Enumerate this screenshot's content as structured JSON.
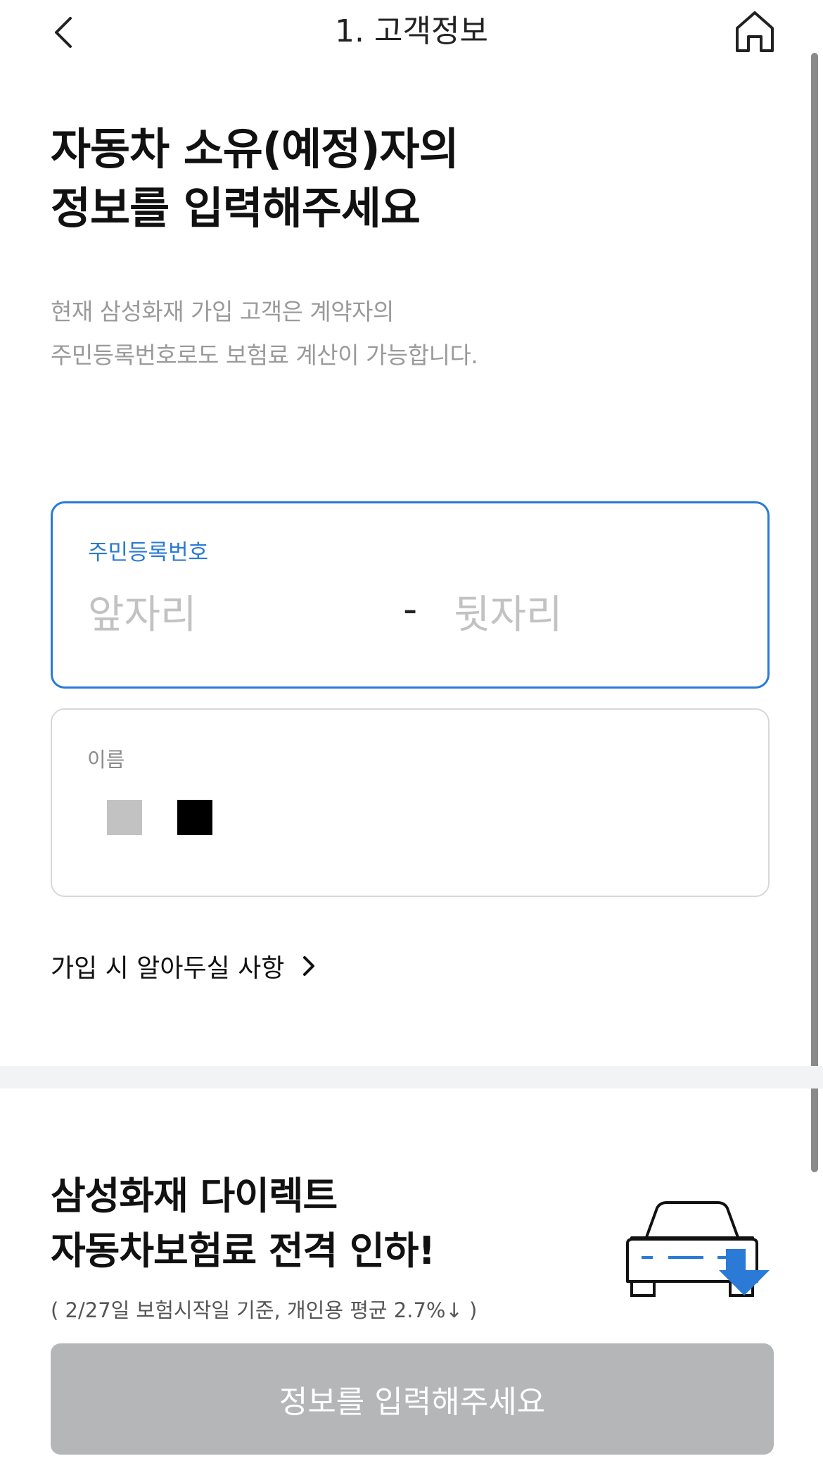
{
  "header": {
    "title": "1. 고객정보"
  },
  "headline": {
    "line1": "자동차 소유(예정)자의",
    "line2": "정보를 입력해주세요"
  },
  "description": {
    "line1": "현재 삼성화재 가입 고객은 계약자의",
    "line2": "주민등록번호로도 보험료 계산이 가능합니다."
  },
  "rrn_field": {
    "label": "주민등록번호",
    "front_placeholder": "앞자리",
    "separator": "-",
    "back_placeholder": "뒷자리",
    "accent_color": "#2a7ad6"
  },
  "name_field": {
    "label": "이름"
  },
  "notice_link": {
    "label": "가입 시 알아두실 사항"
  },
  "promo": {
    "title_line1": "삼성화재 다이렉트",
    "title_line2": "자동차보험료 전격 인하!",
    "note": "( 2/27일 보험시작일 기준, 개인용 평균 2.7%↓ )"
  },
  "submit_button": {
    "label": "정보를 입력해주세요",
    "state": "disabled"
  },
  "icons": {
    "back": "chevron-left-icon",
    "home": "home-icon",
    "notice_arrow": "chevron-right-icon",
    "promo": "car-price-down-icon"
  }
}
